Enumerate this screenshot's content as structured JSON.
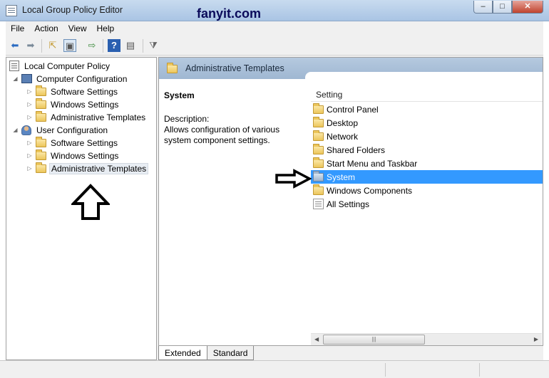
{
  "window": {
    "title": "Local Group Policy Editor",
    "watermark": "fanyit.com",
    "controls": {
      "minimize": "–",
      "maximize": "□",
      "close": "✕"
    }
  },
  "menu": [
    "File",
    "Action",
    "View",
    "Help"
  ],
  "toolbar": {
    "icons": [
      "back-icon",
      "forward-icon",
      "up-folder-icon",
      "show-hide-tree-icon",
      "export-list-icon",
      "help-icon",
      "properties-icon",
      "filter-icon"
    ],
    "glyphs": {
      "back": "⬅",
      "forward": "➡",
      "up": "⇱",
      "tree": "▣",
      "export": "⇨",
      "help": "?",
      "props": "▤",
      "filter": "⧩"
    }
  },
  "tree": {
    "root": "Local Computer Policy",
    "computer": {
      "label": "Computer Configuration",
      "children": [
        "Software Settings",
        "Windows Settings",
        "Administrative Templates"
      ]
    },
    "user": {
      "label": "User Configuration",
      "children": [
        "Software Settings",
        "Windows Settings",
        "Administrative Templates"
      ]
    },
    "expanded_glyph": "◢",
    "collapsed_glyph": "▷"
  },
  "right": {
    "header_title": "Administrative Templates",
    "desc_title": "System",
    "desc_label": "Description:",
    "desc_text": "Allows configuration of various system component settings.",
    "column": "Setting",
    "items": [
      {
        "label": "Control Panel",
        "icon": "folder-icon"
      },
      {
        "label": "Desktop",
        "icon": "folder-icon"
      },
      {
        "label": "Network",
        "icon": "folder-icon"
      },
      {
        "label": "Shared Folders",
        "icon": "folder-icon"
      },
      {
        "label": "Start Menu and Taskbar",
        "icon": "folder-icon"
      },
      {
        "label": "System",
        "icon": "folder-icon",
        "selected": true
      },
      {
        "label": "Windows Components",
        "icon": "folder-icon"
      },
      {
        "label": "All Settings",
        "icon": "all-settings-icon"
      }
    ]
  },
  "tabs": [
    "Extended",
    "Standard"
  ],
  "scrollbar": {
    "left": "◀",
    "right": "▶",
    "grip": "|||"
  },
  "colors": {
    "selection": "#3399ff",
    "header": "#a9c0da",
    "titlebar": "#b9d1ea"
  }
}
